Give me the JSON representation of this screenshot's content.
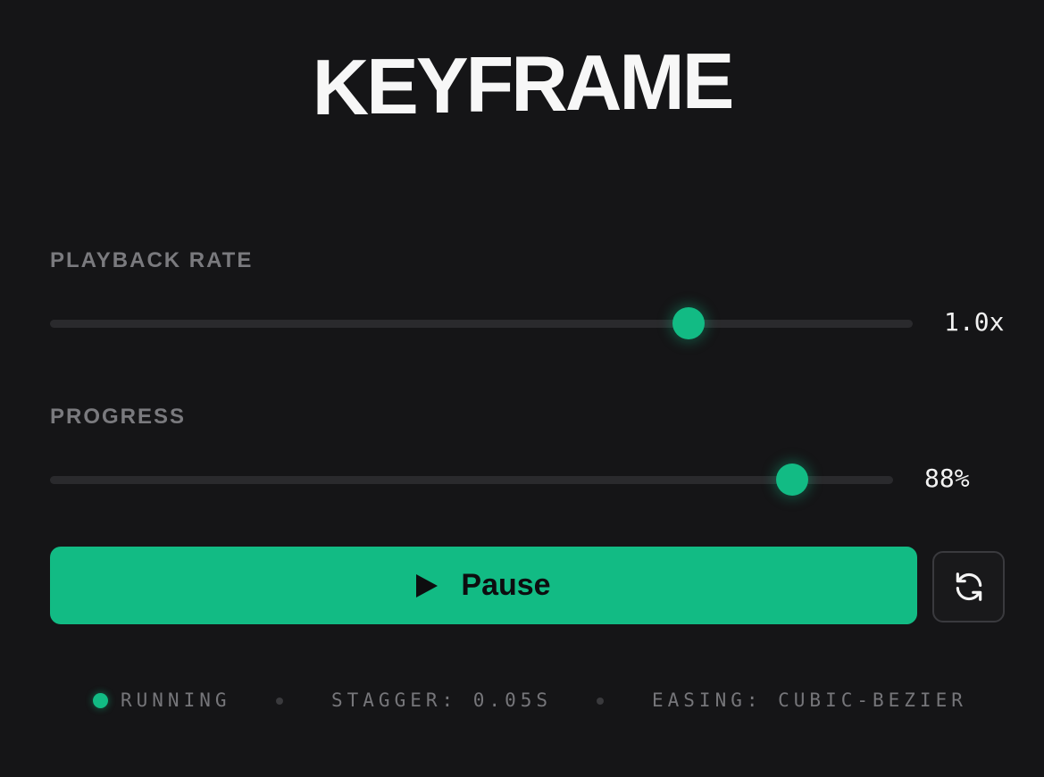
{
  "title": "KEYFRAME",
  "controls": {
    "playback_rate": {
      "label": "PLAYBACK RATE",
      "value_text": "1.0x",
      "position_fraction": 0.74
    },
    "progress": {
      "label": "PROGRESS",
      "value_text": "88%",
      "position_fraction": 0.88
    }
  },
  "actions": {
    "pause_label": "Pause",
    "play_icon": "play-icon",
    "reset_icon": "refresh-icon"
  },
  "status": {
    "state": "RUNNING",
    "stagger": "STAGGER: 0.05S",
    "easing": "EASING: CUBIC-BEZIER"
  },
  "colors": {
    "accent": "#12bb84",
    "background": "#151517",
    "track": "#2a2a2d",
    "label": "#7a7a7e"
  }
}
